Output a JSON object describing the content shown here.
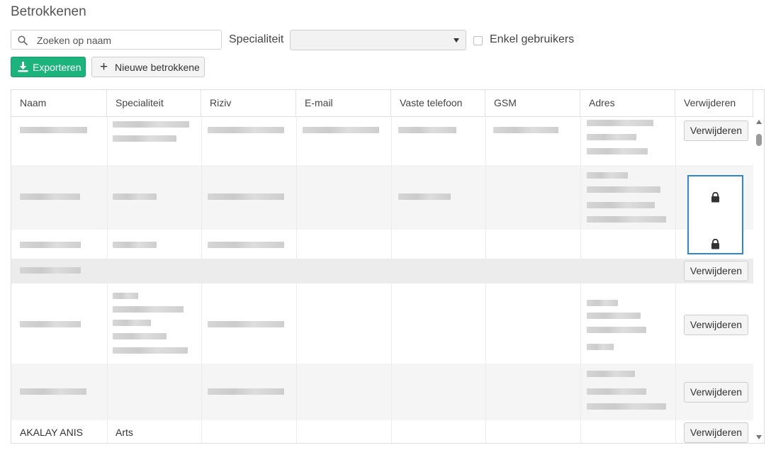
{
  "page": {
    "title": "Betrokkenen"
  },
  "filters": {
    "search_placeholder": "Zoeken op naam",
    "search_value": "",
    "specialty_label": "Specialiteit",
    "specialty_value": "",
    "only_users_label": "Enkel gebruikers",
    "only_users_checked": false
  },
  "toolbar": {
    "export_label": "Exporteren",
    "new_label": "Nieuwe betrokkene"
  },
  "table": {
    "columns": [
      "Naam",
      "Specialiteit",
      "Riziv",
      "E-mail",
      "Vaste telefoon",
      "GSM",
      "Adres",
      "Verwijderen"
    ],
    "delete_label": "Verwijderen",
    "last_row": {
      "name": "AKALAY ANIS",
      "specialty": "Arts"
    }
  },
  "icons": {
    "search": "search-icon",
    "export": "download-icon",
    "new": "plus-icon",
    "lock": "lock-icon",
    "specialty_dropdown": "chevron-down-icon"
  },
  "colors": {
    "accent_green": "#1db37d",
    "focus_blue": "#2f86d4"
  }
}
